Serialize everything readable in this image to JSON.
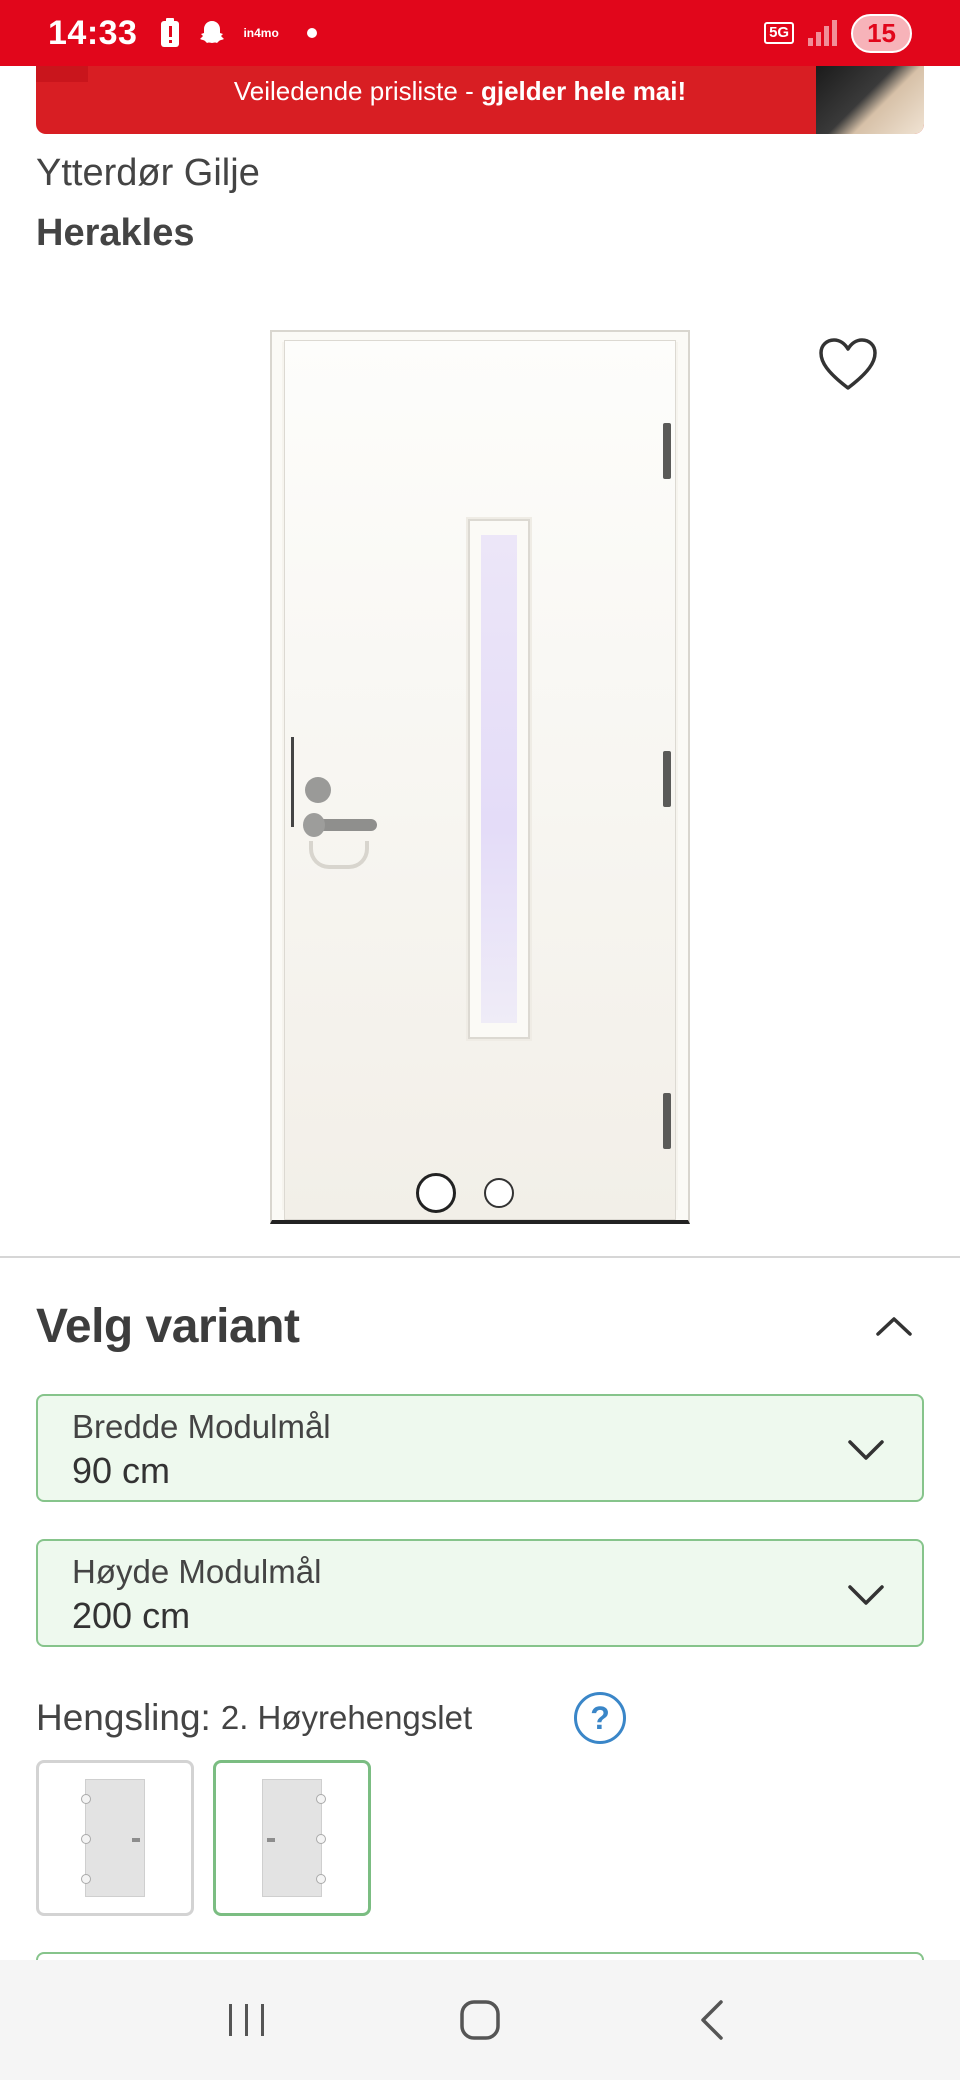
{
  "status_bar": {
    "time": "14:33",
    "app_label": "in4mo",
    "network": "5G",
    "notification_count": "15"
  },
  "promo": {
    "text_normal": "Veiledende prisliste - ",
    "text_bold": "gjelder hele mai!"
  },
  "product": {
    "category": "Ytterdør Gilje",
    "name": "Herakles"
  },
  "gallery": {
    "image_count": 2,
    "active_index": 0,
    "door_color": "#f6f4ee",
    "glass_color": "#e4dcf8"
  },
  "variant": {
    "title": "Velg variant",
    "width": {
      "label": "Bredde Modulmål",
      "value": "90 cm"
    },
    "height": {
      "label": "Høyde Modulmål",
      "value": "200 cm"
    },
    "hinge": {
      "label": "Hengsling:",
      "value": "2. Høyrehengslet",
      "help": "?"
    }
  },
  "colors": {
    "brand_red": "#e1061b",
    "select_bg": "#eef9ee",
    "select_border": "#86c48b",
    "help_blue": "#3a86c8"
  }
}
